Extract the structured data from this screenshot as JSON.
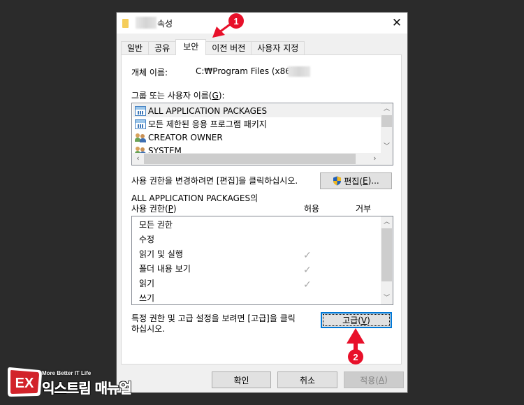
{
  "window": {
    "title_suffix": "속성",
    "close_icon": "✕"
  },
  "tabs": [
    {
      "label": "일반",
      "active": false
    },
    {
      "label": "공유",
      "active": false
    },
    {
      "label": "보안",
      "active": true
    },
    {
      "label": "이전 버전",
      "active": false
    },
    {
      "label": "사용자 지정",
      "active": false
    }
  ],
  "security": {
    "object_name_label": "개체 이름:",
    "object_name_value": "C:₩Program Files (x86)₩",
    "group_label_prefix": "그룹 또는 사용자 이름(",
    "group_label_key": "G",
    "group_label_suffix": "):",
    "principals": [
      {
        "name": "ALL APPLICATION PACKAGES",
        "icon": "app-package-icon",
        "selected": true
      },
      {
        "name": "모든 제한된 응용 프로그램 패키지",
        "icon": "app-package-icon",
        "selected": false
      },
      {
        "name": "CREATOR OWNER",
        "icon": "users-icon",
        "selected": false
      },
      {
        "name": "SYSTEM",
        "icon": "users-icon",
        "selected": false
      }
    ],
    "edit_hint": "사용 권한을 변경하려면 [편집]을 클릭하십시오.",
    "edit_button": {
      "prefix": "편집(",
      "key": "E",
      "suffix": ")..."
    },
    "perm_for_line1": "ALL APPLICATION PACKAGES의",
    "perm_label_prefix": "사용 권한(",
    "perm_label_key": "P",
    "perm_label_suffix": ")",
    "col_allow": "허용",
    "col_deny": "거부",
    "permissions": [
      {
        "name": "모든 권한",
        "allow": false,
        "deny": false
      },
      {
        "name": "수정",
        "allow": false,
        "deny": false
      },
      {
        "name": "읽기 및 실행",
        "allow": true,
        "deny": false
      },
      {
        "name": "폴더 내용 보기",
        "allow": true,
        "deny": false
      },
      {
        "name": "읽기",
        "allow": true,
        "deny": false
      },
      {
        "name": "쓰기",
        "allow": false,
        "deny": false
      }
    ],
    "check_glyph": "✓",
    "advanced_hint_line1": "특정 권한 및 고급 설정을 보려면 [고급]을 클릭",
    "advanced_hint_line2": "하십시오.",
    "advanced_button": {
      "prefix": "고급(",
      "key": "V",
      "suffix": ")"
    }
  },
  "footer": {
    "ok": "확인",
    "cancel": "취소",
    "apply_prefix": "적용(",
    "apply_key": "A",
    "apply_suffix": ")"
  },
  "annotations": [
    {
      "number": "1",
      "target": "보안 tab"
    },
    {
      "number": "2",
      "target": "고급 button"
    }
  ],
  "colors": {
    "annotation_red": "#e8102a",
    "focus_blue": "#0078d7",
    "check_gray": "#a8a8a8"
  },
  "watermark": {
    "tagline": "More Better IT Life",
    "name": "익스트림 매뉴얼",
    "logo_text": "EX"
  }
}
